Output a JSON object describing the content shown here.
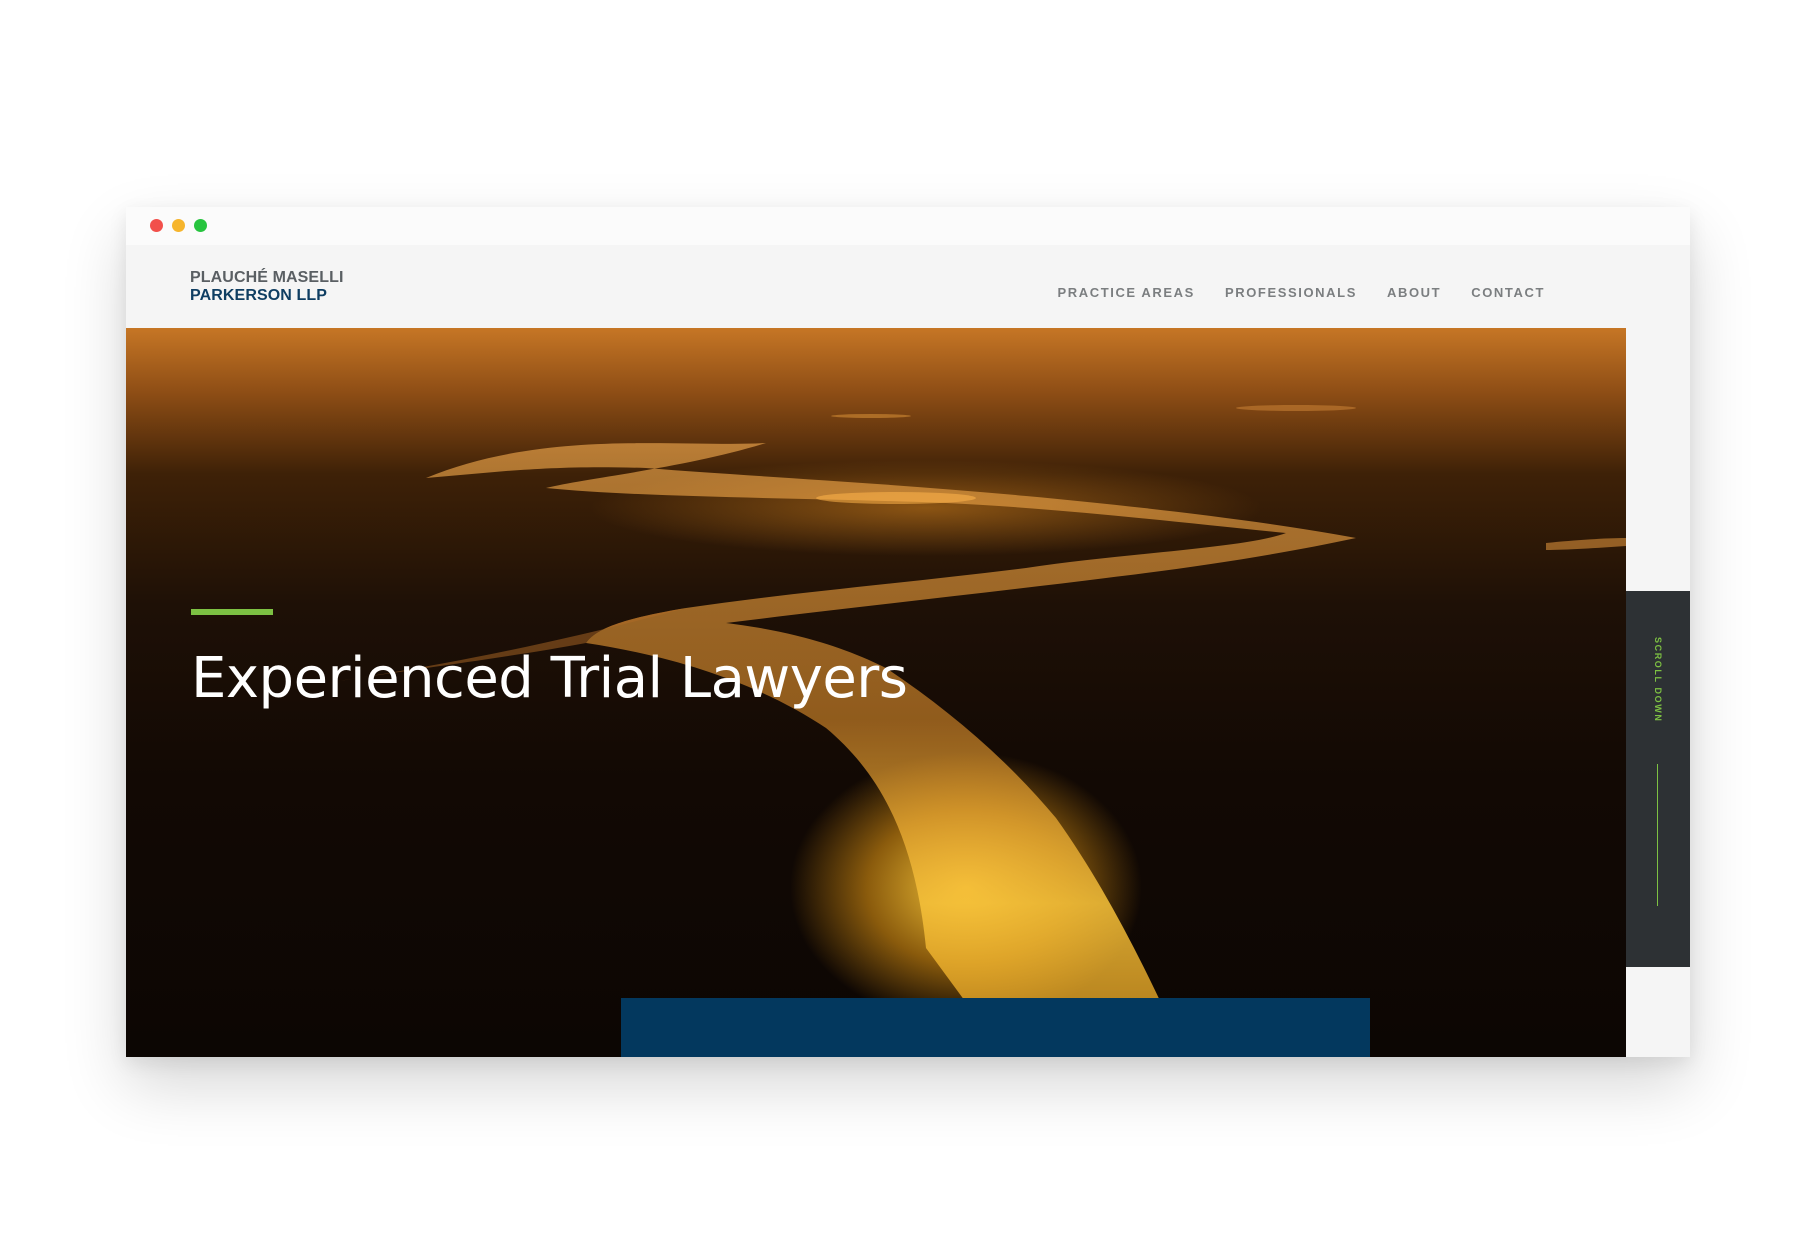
{
  "window": {
    "controls": [
      "close",
      "minimize",
      "maximize"
    ]
  },
  "header": {
    "logo_line1": "PLAUCHÉ MASELLI",
    "logo_line2": "PARKERSON LLP",
    "nav": [
      {
        "label": "PRACTICE AREAS"
      },
      {
        "label": "PROFESSIONALS"
      },
      {
        "label": "ABOUT"
      },
      {
        "label": "CONTACT"
      }
    ]
  },
  "hero": {
    "title": "Experienced Trial Lawyers",
    "image_alt": "aerial-river-sunset"
  },
  "sidebar": {
    "scroll_label": "SCROLL DOWN"
  },
  "colors": {
    "accent_green": "#7dc143",
    "navy": "#03385e",
    "logo_gray": "#5a5f63",
    "logo_navy": "#0f3e62",
    "panel_dark": "#2d3134"
  }
}
